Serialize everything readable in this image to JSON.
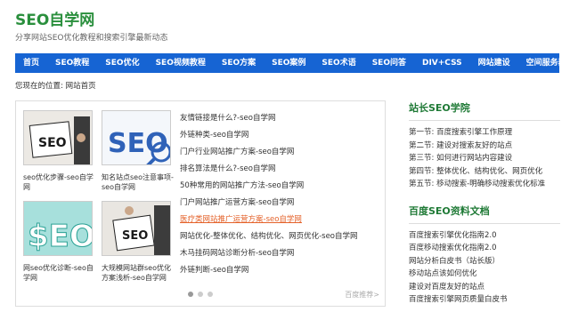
{
  "header": {
    "title": "SEO自学网",
    "subtitle": "分享网站SEO优化教程和搜索引擎最新动态"
  },
  "nav": [
    "首页",
    "SEO教程",
    "SEO优化",
    "SEO视频教程",
    "SEO方案",
    "SEO案例",
    "SEO术语",
    "SEO问答",
    "DIV+CSS",
    "网站建设",
    "空间服务器"
  ],
  "breadcrumb": "您现在的位置: 网站首页",
  "thumbs": [
    {
      "caption": "seo优化步骤-seo自学网",
      "art": "SEO"
    },
    {
      "caption": "知名站点seo注意事项-seo自学网",
      "art": "SEO"
    },
    {
      "caption": "网seo优化诊断-seo自学网",
      "art": "$EO"
    },
    {
      "caption": "大规模网站群seo优化方案浅析-seo自学网",
      "art": "SEO"
    }
  ],
  "articles": [
    "友情链接是什么?-seo自学网",
    "外链种类-seo自学网",
    "门户行业网站推广方案-seo自学网",
    "排名算法是什么?-seo自学网",
    "50种常用的网站推广方法-seo自学网",
    "门户网站推广运营方案-seo自学网",
    "医疗类网站推广运营方案-seo自学网",
    "网站优化-整体优化、结构优化、网页优化-seo自学网",
    "木马挂码网站诊断分析-seo自学网",
    "外链判断-seo自学网"
  ],
  "highlight_index": 6,
  "baidu_recommend": "百度推荐>",
  "sidebar": {
    "academy_title": "站长SEO学院",
    "academy_items": [
      {
        "n": "第一节:",
        "t": "百度搜索引擎工作原理"
      },
      {
        "n": "第二节:",
        "t": "建设对搜索友好的站点"
      },
      {
        "n": "第三节:",
        "t": "如何进行网站内容建设"
      },
      {
        "n": "第四节:",
        "t": "整体优化、结构优化、网页优化"
      },
      {
        "n": "第五节:",
        "t": "移动搜索-明确移动搜索优化标准"
      }
    ],
    "docs_title": "百度SEO资料文档",
    "docs_items": [
      "百度搜索引擎优化指南2.0",
      "百度移动搜索优化指南2.0",
      "网站分析白皮书（站长版）",
      "移动站点该如何优化",
      "建设对百度友好的站点",
      "百度搜索引擎网页质量白皮书"
    ]
  }
}
